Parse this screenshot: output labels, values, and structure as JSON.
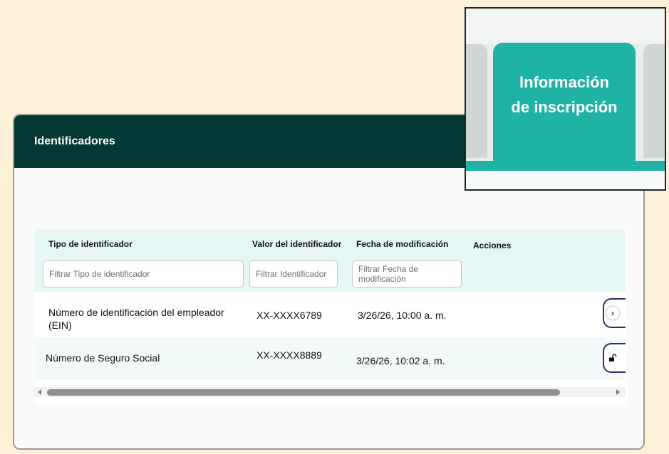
{
  "card": {
    "title": "Identificadores"
  },
  "table": {
    "columns": [
      "Tipo de identificador",
      "Valor del identificador",
      "Fecha de modificación",
      "Acciones"
    ],
    "filters": {
      "tipo": "Filtrar Tipo de identificador",
      "valor": "Filtrar Identificador",
      "fecha": "Filtrar Fecha de modificación"
    },
    "rows": [
      {
        "tipo": "Número de identificación del empleador (EIN)",
        "valor": "XX-XXXX6789",
        "fecha": "3/26/26, 10:00 a. m."
      },
      {
        "tipo": "Número de Seguro Social",
        "valor": "XX-XXXX8889",
        "fecha": "3/26/26, 10:02 a. m."
      }
    ]
  },
  "inset": {
    "label_line1": "Información",
    "label_line2": "de inscripción"
  },
  "icons": {
    "row1_action": "chevron-right-icon",
    "row2_action": "unlock-icon"
  },
  "colors": {
    "header_bg": "#033834",
    "accent": "#1fb3a6",
    "action_border": "#3a2a68",
    "page_bg": "#fdf0d8"
  }
}
